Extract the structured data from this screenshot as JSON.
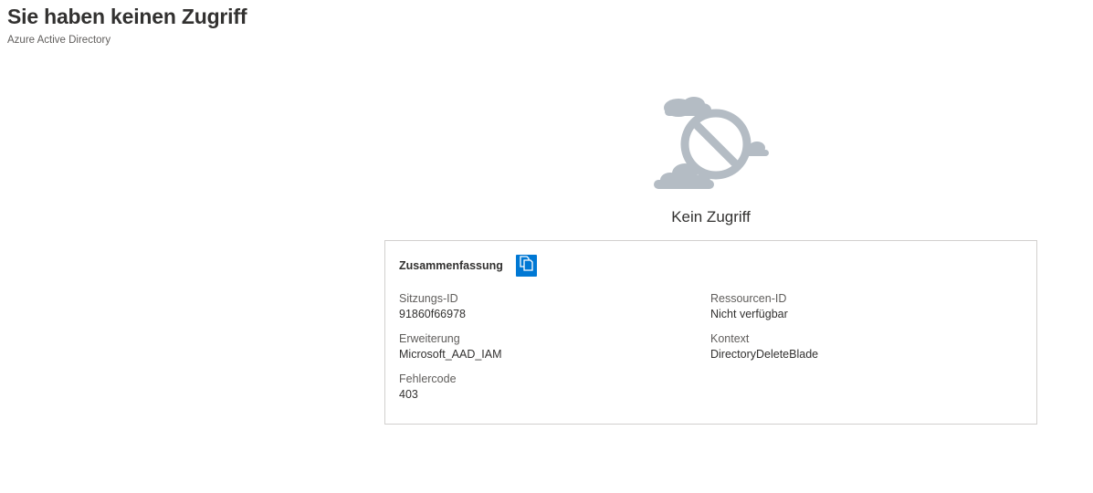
{
  "header": {
    "title": "Sie haben keinen Zugriff",
    "subtitle": "Azure Active Directory"
  },
  "illustration": {
    "icon": "no-access-cloud-icon",
    "color": "#b4bcc4"
  },
  "status": {
    "message": "Kein Zugriff"
  },
  "summary": {
    "title": "Zusammenfassung",
    "copy_icon": "copy-icon",
    "accent_color": "#0078d4",
    "fields": {
      "session_id": {
        "label": "Sitzungs-ID",
        "value": "91860f66978"
      },
      "resource_id": {
        "label": "Ressourcen-ID",
        "value": "Nicht verfügbar"
      },
      "extension": {
        "label": "Erweiterung",
        "value": "Microsoft_AAD_IAM"
      },
      "context": {
        "label": "Kontext",
        "value": "DirectoryDeleteBlade"
      },
      "error_code": {
        "label": "Fehlercode",
        "value": "403"
      }
    }
  }
}
